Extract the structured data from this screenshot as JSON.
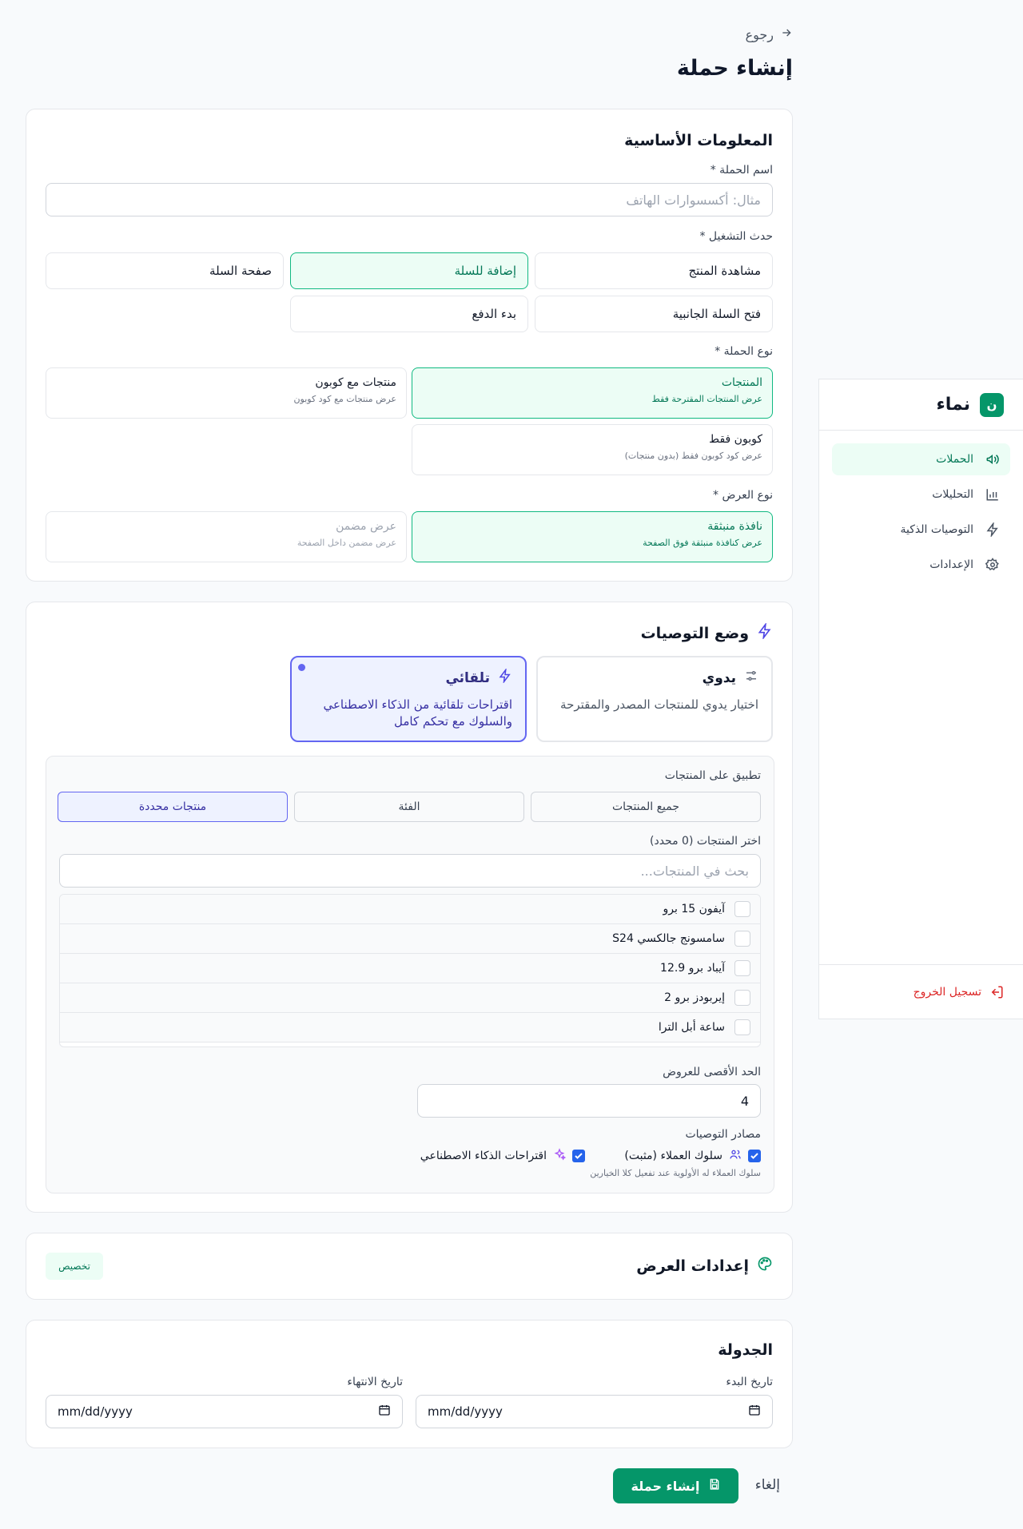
{
  "sidebar": {
    "brand_letter": "ن",
    "brand_name": "نماء",
    "items": [
      {
        "label": "الحملات",
        "icon": "megaphone-icon",
        "active": true
      },
      {
        "label": "التحليلات",
        "icon": "bar-chart-icon"
      },
      {
        "label": "التوصيات الذكية",
        "icon": "lightning-icon"
      },
      {
        "label": "الإعدادات",
        "icon": "gear-icon"
      }
    ],
    "logout": "تسجيل الخروج"
  },
  "header": {
    "back": "رجوع",
    "title": "إنشاء حملة"
  },
  "basic": {
    "title": "المعلومات الأساسية",
    "name_label": "اسم الحملة *",
    "name_placeholder": "مثال: أكسسوارات الهاتف",
    "trigger_label": "حدث التشغيل *",
    "triggers": [
      "مشاهدة المنتج",
      "إضافة للسلة",
      "صفحة السلة",
      "فتح السلة الجانبية",
      "بدء الدفع"
    ],
    "trigger_selected": "إضافة للسلة",
    "type_label": "نوع الحملة *",
    "types": [
      {
        "title": "المنتجات",
        "desc": "عرض المنتجات المقترحة فقط"
      },
      {
        "title": "منتجات مع كوبون",
        "desc": "عرض منتجات مع كود كوبون"
      },
      {
        "title": "كوبون فقط",
        "desc": "عرض كود كوبون فقط (بدون منتجات)"
      }
    ],
    "display_label": "نوع العرض *",
    "displays": [
      {
        "title": "نافذة منبثقة",
        "desc": "عرض كنافذة منبثقة فوق الصفحة"
      },
      {
        "title": "عرض مضمن",
        "desc": "عرض مضمن داخل الصفحة"
      }
    ]
  },
  "reco": {
    "title": "وضع التوصيات",
    "modes": [
      {
        "title": "يدوي",
        "desc": "اختيار يدوي للمنتجات المصدر والمقترحة"
      },
      {
        "title": "تلقائي",
        "desc": "اقتراحات تلقائية من الذكاء الاصطناعي والسلوك مع تحكم كامل"
      }
    ],
    "apply_label": "تطبيق على المنتجات",
    "apply_options": [
      "جميع المنتجات",
      "الفئة",
      "منتجات محددة"
    ],
    "select_label": "اختر المنتجات (0 محدد)",
    "search_placeholder": "بحث في المنتجات...",
    "products": [
      "آيفون 15 برو",
      "سامسونج جالكسي S24",
      "آيباد برو 12.9",
      "إيربودز برو 2",
      "ساعة أبل الترا"
    ],
    "max_label": "الحد الأقصى للعروض",
    "max_value": "4",
    "sources_label": "مصادر التوصيات",
    "source_behavior": "سلوك العملاء (مثبت)",
    "source_ai": "اقتراحات الذكاء الاصطناعي",
    "sources_note": "سلوك العملاء له الأولوية عند تفعيل كلا الخيارين"
  },
  "display_settings": {
    "title": "إعدادات العرض",
    "badge": "تخصيص"
  },
  "schedule": {
    "title": "الجدولة",
    "start_label": "تاريخ البدء",
    "end_label": "تاريخ الانتهاء",
    "date_placeholder": "mm/dd/yyyy"
  },
  "actions": {
    "create": "إنشاء حملة",
    "cancel": "إلغاء"
  },
  "colors": {
    "brand": "#059669",
    "accent": "#6366f1",
    "danger": "#dc2626"
  }
}
